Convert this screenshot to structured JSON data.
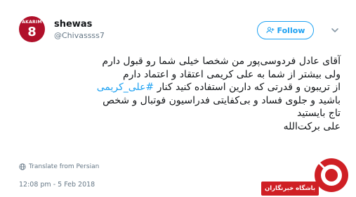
{
  "user": {
    "display_name": "shewas",
    "handle": "@Chivassss7",
    "avatar_text": "AKARIM",
    "avatar_number": "8"
  },
  "follow_button": {
    "label": "Follow"
  },
  "tweet": {
    "lines": [
      "آقای عادل فردوسی‌پور من شخصا خیلی شما رو قبول دارم",
      "ولی بیشتر از شما به علی کریمی اعتقاد و اعتماد دارم",
      "از تریبون و قدرتی که دارین استفاده کنید کنار",
      "باشید و جلوی فساد و بی‌کفایتی فدراسیون فوتبال و شخص",
      "تاج بایستید",
      "علی برکت‌الله"
    ],
    "hashtag": "#علی_کریمی"
  },
  "translate": {
    "label": "Translate from Persian"
  },
  "timestamp": "12:08 pm - 5 Feb 2018",
  "watermark": {
    "label": "باشگاه خبرنگاران"
  },
  "colors": {
    "accent": "#1da1f2",
    "secondary_text": "#657786",
    "watermark_red": "#cf1f24"
  },
  "icons": {
    "follow": "add-user-icon",
    "more": "chevron-down-icon",
    "translate": "globe-icon",
    "watermark": "news-agency-logo-icon"
  }
}
